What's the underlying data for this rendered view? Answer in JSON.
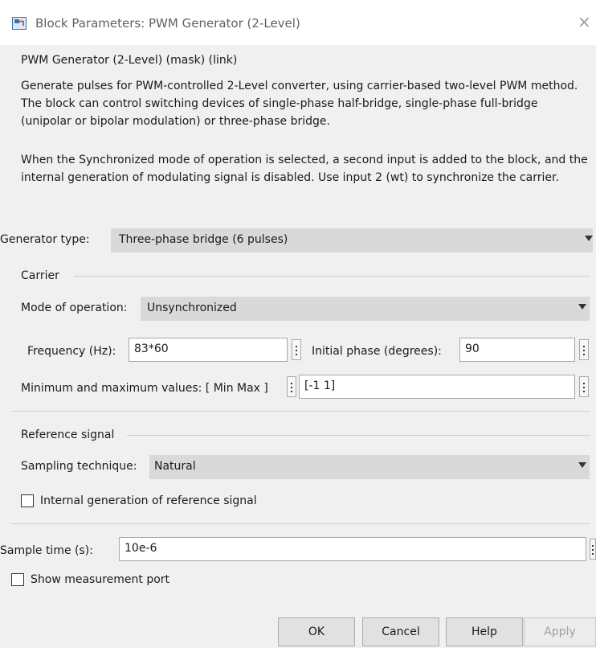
{
  "window": {
    "title": "Block Parameters: PWM Generator (2-Level)",
    "close_symbol": "×"
  },
  "header": {
    "mask_title": "PWM Generator (2-Level) (mask) (link)",
    "description_1": "Generate pulses for PWM-controlled 2-Level converter, using carrier-based two-level PWM method. The block can control switching devices of single-phase half-bridge, single-phase full-bridge (unipolar or bipolar modulation) or three-phase bridge.",
    "description_2": "When the Synchronized mode of operation is selected, a second input is added to the block, and the internal generation of modulating signal is disabled. Use input 2 (wt) to synchronize the carrier."
  },
  "generator_type": {
    "label": "Generator type:",
    "value": "Three-phase bridge (6 pulses)"
  },
  "carrier": {
    "section_label": "Carrier",
    "mode_label": "Mode of operation:",
    "mode_value": "Unsynchronized",
    "frequency_label": "Frequency (Hz):",
    "frequency_value": "83*60",
    "phase_label": "Initial phase (degrees):",
    "phase_value": "90",
    "minmax_label": "Minimum and maximum values: [ Min  Max ]",
    "minmax_value": "[-1  1]"
  },
  "reference": {
    "section_label": "Reference signal",
    "sampling_label": "Sampling technique:",
    "sampling_value": "Natural",
    "internal_gen_label": "Internal generation of reference signal",
    "internal_gen_checked": false
  },
  "sample_time": {
    "label": "Sample time (s):",
    "value": "10e-6"
  },
  "measurement": {
    "label": "Show measurement port",
    "checked": false
  },
  "buttons": {
    "ok": "OK",
    "cancel": "Cancel",
    "help": "Help",
    "apply": "Apply"
  },
  "icons": {
    "title_icon": "simulink-block-icon",
    "close_icon": "close-icon",
    "dropdown_icon": "chevron-down-icon",
    "more_icon": "vertical-ellipsis-icon"
  }
}
